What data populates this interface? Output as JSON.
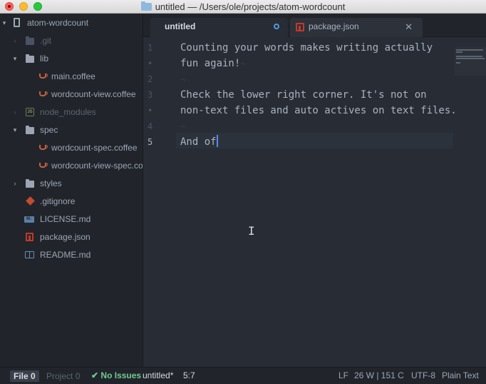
{
  "window": {
    "title": "untitled — /Users/ole/projects/atom-wordcount"
  },
  "tree": {
    "root": "atom-wordcount",
    "items": [
      {
        "label": ".git"
      },
      {
        "label": "lib"
      },
      {
        "label": "main.coffee"
      },
      {
        "label": "wordcount-view.coffee"
      },
      {
        "label": "node_modules"
      },
      {
        "label": "spec"
      },
      {
        "label": "wordcount-spec.coffee"
      },
      {
        "label": "wordcount-view-spec.coffee"
      },
      {
        "label": "styles"
      },
      {
        "label": ".gitignore"
      },
      {
        "label": "LICENSE.md"
      },
      {
        "label": "package.json"
      },
      {
        "label": "README.md"
      }
    ],
    "js_badge": "JS",
    "md_badge": "M↓"
  },
  "tabs": [
    {
      "label": "untitled"
    },
    {
      "label": "package.json"
    }
  ],
  "editor": {
    "gutter": [
      "1",
      "•",
      "2",
      "3",
      "•",
      "4",
      "5"
    ],
    "lines": [
      "Counting your words makes writing actually",
      "fun again!",
      "",
      "Check the lower right corner. It's not on",
      "non-text files and auto actives on text files.",
      "",
      "And of"
    ],
    "eol_marker": "¬"
  },
  "status": {
    "file_tab": "File",
    "file_count": "0",
    "project_tab": "Project",
    "project_count": "0",
    "issues": "No Issues",
    "filename": "untitled*",
    "cursor_pos": "5:7",
    "line_ending": "LF",
    "word_count": "26 W | 151 C",
    "encoding": "UTF-8",
    "grammar": "Plain Text"
  },
  "icons": {
    "check": "check-icon",
    "close": "close-icon",
    "modified": "modified-dot-icon"
  },
  "colors": {
    "accent": "#528bff",
    "success": "#73c990",
    "background": "#282c34"
  }
}
